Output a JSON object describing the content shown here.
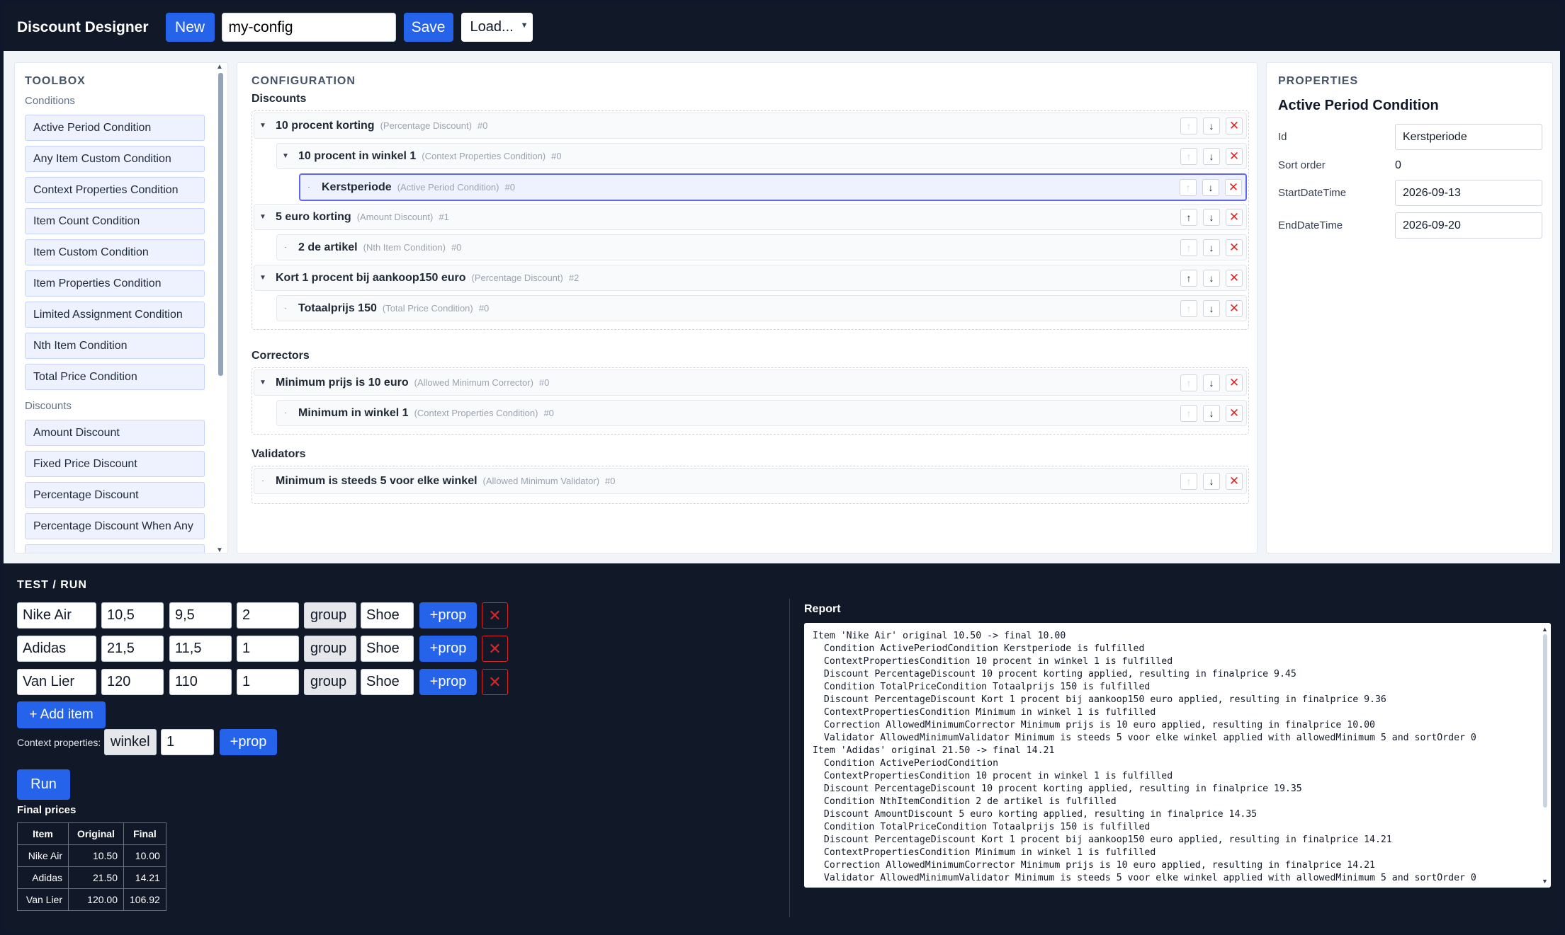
{
  "header": {
    "title": "Discount Designer",
    "new_label": "New",
    "config_name": "my-config",
    "save_label": "Save",
    "load_label": "Load..."
  },
  "toolbox": {
    "title": "TOOLBOX",
    "conditions_label": "Conditions",
    "conditions": [
      "Active Period Condition",
      "Any Item Custom Condition",
      "Context Properties Condition",
      "Item Count Condition",
      "Item Custom Condition",
      "Item Properties Condition",
      "Limited Assignment Condition",
      "Nth Item Condition",
      "Total Price Condition"
    ],
    "discounts_label": "Discounts",
    "discounts": [
      "Amount Discount",
      "Fixed Price Discount",
      "Percentage Discount",
      "Percentage Discount When Any"
    ]
  },
  "configuration": {
    "title": "CONFIGURATION",
    "discounts_label": "Discounts",
    "correctors_label": "Correctors",
    "validators_label": "Validators",
    "nodes": [
      {
        "name": "10 procent korting",
        "type": "(Percentage Discount)",
        "sort": "#0"
      },
      {
        "name": "10 procent in winkel 1",
        "type": "(Context Properties Condition)",
        "sort": "#0"
      },
      {
        "name": "Kerstperiode",
        "type": "(Active Period Condition)",
        "sort": "#0"
      },
      {
        "name": "5 euro korting",
        "type": "(Amount Discount)",
        "sort": "#1"
      },
      {
        "name": "2 de artikel",
        "type": "(Nth Item Condition)",
        "sort": "#0"
      },
      {
        "name": "Kort 1 procent bij aankoop150 euro",
        "type": "(Percentage Discount)",
        "sort": "#2"
      },
      {
        "name": "Totaalprijs 150",
        "type": "(Total Price Condition)",
        "sort": "#0"
      },
      {
        "name": "Minimum prijs is 10 euro",
        "type": "(Allowed Minimum Corrector)",
        "sort": "#0"
      },
      {
        "name": "Minimum in winkel 1",
        "type": "(Context Properties Condition)",
        "sort": "#0"
      },
      {
        "name": "Minimum is steeds 5 voor elke winkel",
        "type": "(Allowed Minimum Validator)",
        "sort": "#0"
      }
    ]
  },
  "properties": {
    "title": "PROPERTIES",
    "heading": "Active Period Condition",
    "id_label": "Id",
    "id_value": "Kerstperiode",
    "sort_label": "Sort order",
    "sort_value": "0",
    "start_label": "StartDateTime",
    "start_value": "2026-09-13",
    "end_label": "EndDateTime",
    "end_value": "2026-09-20"
  },
  "test": {
    "title": "TEST / RUN",
    "items": [
      {
        "name": "Nike Air",
        "original": "10,5",
        "min": "9,5",
        "qty": "2",
        "group": "group",
        "type": "Shoe"
      },
      {
        "name": "Adidas",
        "original": "21,5",
        "min": "11,5",
        "qty": "1",
        "group": "group",
        "type": "Shoe"
      },
      {
        "name": "Van Lier",
        "original": "120",
        "min": "110",
        "qty": "1",
        "group": "group",
        "type": "Shoe"
      }
    ],
    "prop_label": "+prop",
    "add_item_label": "+ Add item",
    "context_label": "Context properties:",
    "context_key": "winkel",
    "context_value": "1",
    "run_label": "Run",
    "final_title": "Final prices",
    "final_headers": [
      "Item",
      "Original",
      "Final"
    ],
    "final_rows": [
      [
        "Nike Air",
        "10.50",
        "10.00"
      ],
      [
        "Adidas",
        "21.50",
        "14.21"
      ],
      [
        "Van Lier",
        "120.00",
        "106.92"
      ]
    ],
    "report_title": "Report",
    "report_lines": [
      "Item 'Nike Air' original 10.50 -> final 10.00",
      "  Condition ActivePeriodCondition Kerstperiode is fulfilled",
      "  ContextPropertiesCondition 10 procent in winkel 1 is fulfilled",
      "  Discount PercentageDiscount 10 procent korting applied, resulting in finalprice 9.45",
      "  Condition TotalPriceCondition Totaalprijs 150 is fulfilled",
      "  Discount PercentageDiscount Kort 1 procent bij aankoop150 euro applied, resulting in finalprice 9.36",
      "  ContextPropertiesCondition Minimum in winkel 1 is fulfilled",
      "  Correction AllowedMinimumCorrector Minimum prijs is 10 euro applied, resulting in finalprice 10.00",
      "  Validator AllowedMinimumValidator Minimum is steeds 5 voor elke winkel applied with allowedMinimum 5 and sortOrder 0",
      "Item 'Adidas' original 21.50 -> final 14.21",
      "  Condition ActivePeriodCondition",
      "  ContextPropertiesCondition 10 procent in winkel 1 is fulfilled",
      "  Discount PercentageDiscount 10 procent korting applied, resulting in finalprice 19.35",
      "  Condition NthItemCondition 2 de artikel is fulfilled",
      "  Discount AmountDiscount 5 euro korting applied, resulting in finalprice 14.35",
      "  Condition TotalPriceCondition Totaalprijs 150 is fulfilled",
      "  Discount PercentageDiscount Kort 1 procent bij aankoop150 euro applied, resulting in finalprice 14.21",
      "  ContextPropertiesCondition Minimum in winkel 1 is fulfilled",
      "  Correction AllowedMinimumCorrector Minimum prijs is 10 euro applied, resulting in finalprice 14.21",
      "  Validator AllowedMinimumValidator Minimum is steeds 5 voor elke winkel applied with allowedMinimum 5 and sortOrder 0"
    ]
  },
  "colors": {
    "accent": "#2563eb",
    "dark_bg": "#111827",
    "danger": "#dc2626",
    "selected_border": "#6366f1"
  }
}
